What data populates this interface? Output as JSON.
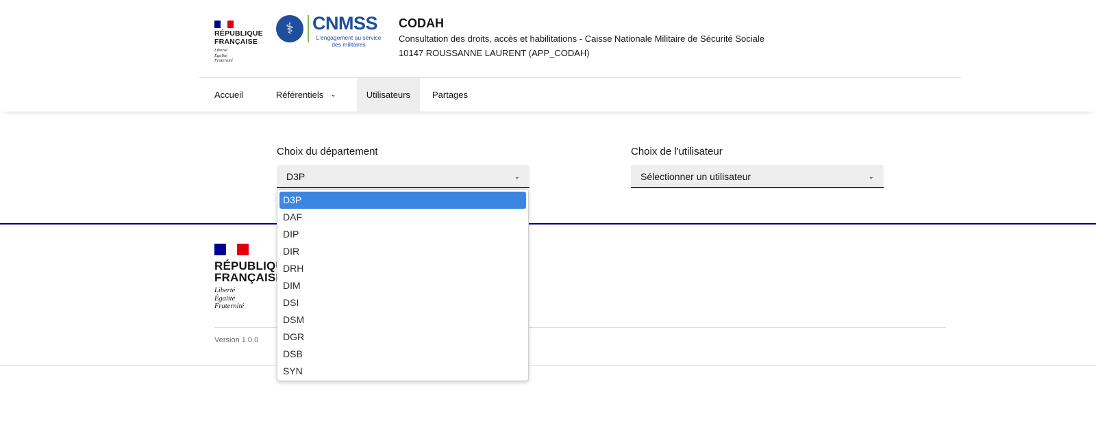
{
  "header": {
    "rf_logo": {
      "line1": "RÉPUBLIQUE",
      "line2": "FRANÇAISE",
      "motto1": "Liberté",
      "motto2": "Égalité",
      "motto3": "Fraternité"
    },
    "cnmss_logo": {
      "word": "CNMSS",
      "sub1": "L'engagement au service",
      "sub2": "des militaires"
    },
    "app_title": "CODAH",
    "app_description": "Consultation des droits, accès et habilitations - Caisse Nationale Militaire de Sécurité Sociale",
    "user": "10147 ROUSSANNE LAURENT (APP_CODAH)"
  },
  "nav": {
    "items": [
      {
        "label": "Accueil"
      },
      {
        "label": "Référentiels"
      },
      {
        "label": "Utilisateurs"
      },
      {
        "label": "Partages"
      }
    ]
  },
  "main": {
    "department": {
      "label": "Choix du département",
      "value": "D3P",
      "options": [
        "D3P",
        "DAF",
        "DIP",
        "DIR",
        "DRH",
        "DIM",
        "DSI",
        "DSM",
        "DGR",
        "DSB",
        "SYN"
      ]
    },
    "user_select": {
      "label": "Choix de l'utilisateur",
      "value": "Sélectionner un utilisateur"
    }
  },
  "footer": {
    "rf_logo": {
      "line1": "RÉPUBLIQUE",
      "line2": "FRANÇAISE",
      "motto1": "Liberté",
      "motto2": "Égalité",
      "motto3": "Fraternité"
    },
    "version": "Version 1.0.0"
  },
  "colors": {
    "flag_blue": "#000091",
    "flag_red": "#e1000f",
    "brand_blue": "#1f4e9c",
    "selected_option": "#3a86e0",
    "active_nav": "#eeeeee"
  }
}
